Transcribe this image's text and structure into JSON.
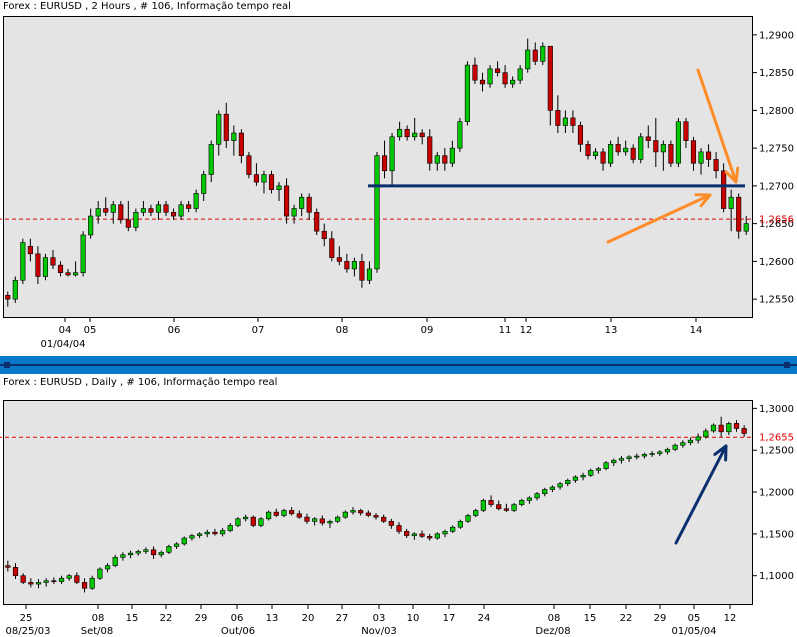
{
  "top_chart": {
    "title": "Forex : EURUSD , 2 Hours , # 106, Informação tempo real",
    "colors": {
      "up": "#00c800",
      "down": "#c80000",
      "support_line": "#0a2f6e",
      "price_line": "#e00000",
      "arrow": "#ff8c28",
      "plot_bg": "#e4e4e4"
    }
  },
  "bottom_chart": {
    "title": "Forex : EURUSD , Daily , # 106, Informação tempo real",
    "colors": {
      "up": "#00c800",
      "down": "#c80000",
      "price_line": "#e00000",
      "arrow": "#0a2f6e",
      "plot_bg": "#e4e4e4"
    }
  },
  "chart_data": [
    {
      "type": "candlestick",
      "title": "Forex : EURUSD , 2 Hours , # 106, Informação tempo real",
      "ylim": [
        1.2525,
        1.2925
      ],
      "y_ticks": [
        "1,2550",
        "1,2600",
        "1,2650",
        "1,2700",
        "1,2750",
        "1,2800",
        "1,2850",
        "1,2900"
      ],
      "x_tick_labels": [
        "04",
        "05",
        "06",
        "07",
        "08",
        "09",
        "11",
        "12",
        "13",
        "14"
      ],
      "x_sub_label": "01/04/04",
      "current_price": 1.2656,
      "current_price_label": "1,2656",
      "horizontal_lines": [
        {
          "value": 1.27,
          "color": "#0a2f6e"
        }
      ],
      "annotations": [
        "orange arrow pointing down to the support line",
        "orange arrow pointing up to the support line"
      ],
      "candles": [
        [
          1.2555,
          1.256,
          1.254,
          1.255
        ],
        [
          1.255,
          1.258,
          1.2545,
          1.2575
        ],
        [
          1.2575,
          1.263,
          1.257,
          1.2625
        ],
        [
          1.262,
          1.263,
          1.26,
          1.261
        ],
        [
          1.261,
          1.262,
          1.257,
          1.258
        ],
        [
          1.258,
          1.261,
          1.2575,
          1.2605
        ],
        [
          1.2605,
          1.2615,
          1.259,
          1.2595
        ],
        [
          1.2595,
          1.26,
          1.258,
          1.2585
        ],
        [
          1.2585,
          1.259,
          1.258,
          1.2582
        ],
        [
          1.2582,
          1.26,
          1.258,
          1.2585
        ],
        [
          1.2585,
          1.264,
          1.258,
          1.2635
        ],
        [
          1.2635,
          1.267,
          1.263,
          1.266
        ],
        [
          1.266,
          1.268,
          1.265,
          1.267
        ],
        [
          1.267,
          1.2685,
          1.266,
          1.2665
        ],
        [
          1.2665,
          1.268,
          1.265,
          1.2675
        ],
        [
          1.2675,
          1.268,
          1.265,
          1.2655
        ],
        [
          1.2655,
          1.268,
          1.264,
          1.2645
        ],
        [
          1.2645,
          1.267,
          1.264,
          1.2665
        ],
        [
          1.2665,
          1.268,
          1.266,
          1.267
        ],
        [
          1.267,
          1.2675,
          1.266,
          1.2665
        ],
        [
          1.2665,
          1.268,
          1.2655,
          1.2675
        ],
        [
          1.2675,
          1.268,
          1.266,
          1.2665
        ],
        [
          1.2665,
          1.267,
          1.2655,
          1.266
        ],
        [
          1.266,
          1.268,
          1.2655,
          1.2675
        ],
        [
          1.2675,
          1.268,
          1.2665,
          1.267
        ],
        [
          1.267,
          1.2695,
          1.2665,
          1.269
        ],
        [
          1.269,
          1.272,
          1.268,
          1.2715
        ],
        [
          1.2715,
          1.276,
          1.2705,
          1.2755
        ],
        [
          1.2755,
          1.28,
          1.274,
          1.2795
        ],
        [
          1.2795,
          1.281,
          1.275,
          1.276
        ],
        [
          1.276,
          1.278,
          1.274,
          1.277
        ],
        [
          1.277,
          1.2775,
          1.273,
          1.274
        ],
        [
          1.274,
          1.2745,
          1.271,
          1.2715
        ],
        [
          1.2715,
          1.273,
          1.27,
          1.2705
        ],
        [
          1.2705,
          1.272,
          1.269,
          1.2715
        ],
        [
          1.2715,
          1.272,
          1.269,
          1.2695
        ],
        [
          1.2695,
          1.2705,
          1.268,
          1.27
        ],
        [
          1.27,
          1.271,
          1.265,
          1.266
        ],
        [
          1.266,
          1.2675,
          1.265,
          1.267
        ],
        [
          1.267,
          1.269,
          1.266,
          1.2685
        ],
        [
          1.2685,
          1.269,
          1.2655,
          1.2665
        ],
        [
          1.2665,
          1.267,
          1.2635,
          1.264
        ],
        [
          1.264,
          1.265,
          1.262,
          1.263
        ],
        [
          1.263,
          1.264,
          1.26,
          1.2605
        ],
        [
          1.2605,
          1.262,
          1.2595,
          1.26
        ],
        [
          1.26,
          1.261,
          1.2585,
          1.259
        ],
        [
          1.259,
          1.2605,
          1.258,
          1.26
        ],
        [
          1.26,
          1.261,
          1.2565,
          1.2575
        ],
        [
          1.2575,
          1.26,
          1.257,
          1.259
        ],
        [
          1.259,
          1.2745,
          1.2585,
          1.274
        ],
        [
          1.274,
          1.276,
          1.271,
          1.272
        ],
        [
          1.272,
          1.277,
          1.27,
          1.2765
        ],
        [
          1.2765,
          1.2785,
          1.276,
          1.2775
        ],
        [
          1.2775,
          1.278,
          1.276,
          1.2765
        ],
        [
          1.2765,
          1.279,
          1.276,
          1.277
        ],
        [
          1.277,
          1.2775,
          1.2755,
          1.2765
        ],
        [
          1.2765,
          1.2775,
          1.272,
          1.273
        ],
        [
          1.273,
          1.2745,
          1.272,
          1.274
        ],
        [
          1.274,
          1.275,
          1.272,
          1.273
        ],
        [
          1.273,
          1.276,
          1.2725,
          1.275
        ],
        [
          1.275,
          1.279,
          1.2745,
          1.2785
        ],
        [
          1.2785,
          1.2865,
          1.278,
          1.286
        ],
        [
          1.286,
          1.287,
          1.2835,
          1.284
        ],
        [
          1.284,
          1.285,
          1.2825,
          1.2835
        ],
        [
          1.2835,
          1.286,
          1.283,
          1.2855
        ],
        [
          1.2855,
          1.2865,
          1.2845,
          1.285
        ],
        [
          1.285,
          1.286,
          1.283,
          1.2835
        ],
        [
          1.2835,
          1.2845,
          1.283,
          1.284
        ],
        [
          1.284,
          1.286,
          1.2835,
          1.2855
        ],
        [
          1.2855,
          1.2895,
          1.285,
          1.288
        ],
        [
          1.288,
          1.289,
          1.286,
          1.2865
        ],
        [
          1.2865,
          1.289,
          1.286,
          1.2885
        ],
        [
          1.2885,
          1.288,
          1.278,
          1.28
        ],
        [
          1.28,
          1.282,
          1.277,
          1.278
        ],
        [
          1.278,
          1.28,
          1.277,
          1.279
        ],
        [
          1.279,
          1.28,
          1.277,
          1.278
        ],
        [
          1.278,
          1.2785,
          1.2745,
          1.2755
        ],
        [
          1.2755,
          1.276,
          1.2735,
          1.274
        ],
        [
          1.274,
          1.275,
          1.2735,
          1.2745
        ],
        [
          1.2745,
          1.275,
          1.272,
          1.273
        ],
        [
          1.273,
          1.276,
          1.2725,
          1.2755
        ],
        [
          1.2755,
          1.2765,
          1.274,
          1.2745
        ],
        [
          1.2745,
          1.276,
          1.274,
          1.275
        ],
        [
          1.275,
          1.2755,
          1.273,
          1.2735
        ],
        [
          1.2735,
          1.277,
          1.273,
          1.2765
        ],
        [
          1.2765,
          1.278,
          1.275,
          1.276
        ],
        [
          1.276,
          1.279,
          1.2725,
          1.2745
        ],
        [
          1.2745,
          1.276,
          1.272,
          1.2755
        ],
        [
          1.2755,
          1.276,
          1.2725,
          1.273
        ],
        [
          1.273,
          1.279,
          1.2725,
          1.2785
        ],
        [
          1.2785,
          1.279,
          1.275,
          1.276
        ],
        [
          1.276,
          1.2765,
          1.272,
          1.273
        ],
        [
          1.273,
          1.275,
          1.2715,
          1.2745
        ],
        [
          1.2745,
          1.2755,
          1.2725,
          1.2735
        ],
        [
          1.2735,
          1.2745,
          1.271,
          1.272
        ],
        [
          1.272,
          1.273,
          1.2665,
          1.267
        ],
        [
          1.267,
          1.2695,
          1.264,
          1.2685
        ],
        [
          1.2685,
          1.269,
          1.263,
          1.264
        ],
        [
          1.264,
          1.266,
          1.2635,
          1.265
        ]
      ]
    },
    {
      "type": "candlestick",
      "title": "Forex : EURUSD , Daily , # 106, Informação tempo real",
      "ylim": [
        1.065,
        1.31
      ],
      "y_ticks": [
        "1,1000",
        "1,1500",
        "1,2000",
        "1,2500",
        "1,3000"
      ],
      "x_tick_labels": [
        "25",
        "08",
        "15",
        "22",
        "29",
        "06",
        "13",
        "20",
        "27",
        "03",
        "10",
        "17",
        "24",
        "08",
        "15",
        "22",
        "29",
        "05",
        "12"
      ],
      "x_sub_labels": [
        "08/25/03",
        "Set/08",
        "Out/06",
        "Nov/03",
        "Dez/08",
        "01/05/04"
      ],
      "current_price": 1.2655,
      "current_price_label": "1,2655",
      "annotations": [
        "dark blue arrow pointing up to the recent candles"
      ],
      "candles": [
        [
          1.112,
          1.118,
          1.105,
          1.11
        ],
        [
          1.11,
          1.115,
          1.096,
          1.1
        ],
        [
          1.1,
          1.103,
          1.09,
          1.092
        ],
        [
          1.092,
          1.097,
          1.086,
          1.09
        ],
        [
          1.09,
          1.096,
          1.085,
          1.092
        ],
        [
          1.092,
          1.097,
          1.087,
          1.094
        ],
        [
          1.094,
          1.098,
          1.09,
          1.093
        ],
        [
          1.093,
          1.1,
          1.09,
          1.097
        ],
        [
          1.097,
          1.102,
          1.094,
          1.1
        ],
        [
          1.1,
          1.104,
          1.09,
          1.092
        ],
        [
          1.092,
          1.097,
          1.08,
          1.085
        ],
        [
          1.085,
          1.1,
          1.083,
          1.097
        ],
        [
          1.097,
          1.11,
          1.095,
          1.108
        ],
        [
          1.108,
          1.115,
          1.104,
          1.112
        ],
        [
          1.112,
          1.125,
          1.11,
          1.122
        ],
        [
          1.122,
          1.128,
          1.118,
          1.125
        ],
        [
          1.125,
          1.13,
          1.121,
          1.127
        ],
        [
          1.127,
          1.131,
          1.124,
          1.129
        ],
        [
          1.129,
          1.134,
          1.126,
          1.131
        ],
        [
          1.131,
          1.135,
          1.12,
          1.125
        ],
        [
          1.125,
          1.13,
          1.122,
          1.128
        ],
        [
          1.128,
          1.137,
          1.126,
          1.135
        ],
        [
          1.135,
          1.14,
          1.132,
          1.138
        ],
        [
          1.138,
          1.147,
          1.136,
          1.145
        ],
        [
          1.145,
          1.15,
          1.142,
          1.148
        ],
        [
          1.148,
          1.152,
          1.145,
          1.15
        ],
        [
          1.15,
          1.155,
          1.146,
          1.152
        ],
        [
          1.152,
          1.156,
          1.148,
          1.15
        ],
        [
          1.15,
          1.157,
          1.147,
          1.154
        ],
        [
          1.154,
          1.163,
          1.152,
          1.16
        ],
        [
          1.16,
          1.17,
          1.158,
          1.168
        ],
        [
          1.168,
          1.173,
          1.165,
          1.17
        ],
        [
          1.17,
          1.172,
          1.158,
          1.16
        ],
        [
          1.16,
          1.17,
          1.158,
          1.168
        ],
        [
          1.168,
          1.178,
          1.166,
          1.176
        ],
        [
          1.176,
          1.18,
          1.17,
          1.172
        ],
        [
          1.172,
          1.18,
          1.17,
          1.178
        ],
        [
          1.178,
          1.182,
          1.172,
          1.174
        ],
        [
          1.174,
          1.178,
          1.168,
          1.17
        ],
        [
          1.17,
          1.174,
          1.162,
          1.165
        ],
        [
          1.165,
          1.17,
          1.16,
          1.168
        ],
        [
          1.168,
          1.172,
          1.16,
          1.163
        ],
        [
          1.163,
          1.167,
          1.157,
          1.165
        ],
        [
          1.165,
          1.172,
          1.163,
          1.17
        ],
        [
          1.17,
          1.178,
          1.168,
          1.176
        ],
        [
          1.176,
          1.182,
          1.173,
          1.178
        ],
        [
          1.178,
          1.18,
          1.172,
          1.175
        ],
        [
          1.175,
          1.178,
          1.17,
          1.172
        ],
        [
          1.172,
          1.175,
          1.167,
          1.17
        ],
        [
          1.17,
          1.173,
          1.163,
          1.165
        ],
        [
          1.165,
          1.168,
          1.156,
          1.16
        ],
        [
          1.16,
          1.164,
          1.15,
          1.153
        ],
        [
          1.153,
          1.156,
          1.145,
          1.148
        ],
        [
          1.148,
          1.152,
          1.143,
          1.15
        ],
        [
          1.15,
          1.154,
          1.145,
          1.147
        ],
        [
          1.147,
          1.15,
          1.142,
          1.145
        ],
        [
          1.145,
          1.152,
          1.143,
          1.15
        ],
        [
          1.15,
          1.155,
          1.146,
          1.153
        ],
        [
          1.153,
          1.16,
          1.151,
          1.158
        ],
        [
          1.158,
          1.167,
          1.156,
          1.165
        ],
        [
          1.165,
          1.174,
          1.163,
          1.172
        ],
        [
          1.172,
          1.18,
          1.17,
          1.178
        ],
        [
          1.178,
          1.192,
          1.176,
          1.19
        ],
        [
          1.19,
          1.196,
          1.182,
          1.185
        ],
        [
          1.185,
          1.19,
          1.178,
          1.18
        ],
        [
          1.18,
          1.186,
          1.176,
          1.178
        ],
        [
          1.178,
          1.187,
          1.176,
          1.185
        ],
        [
          1.185,
          1.192,
          1.183,
          1.19
        ],
        [
          1.19,
          1.195,
          1.186,
          1.193
        ],
        [
          1.193,
          1.2,
          1.19,
          1.198
        ],
        [
          1.198,
          1.205,
          1.195,
          1.203
        ],
        [
          1.203,
          1.208,
          1.2,
          1.206
        ],
        [
          1.206,
          1.212,
          1.203,
          1.21
        ],
        [
          1.21,
          1.216,
          1.207,
          1.214
        ],
        [
          1.214,
          1.22,
          1.211,
          1.218
        ],
        [
          1.218,
          1.223,
          1.214,
          1.22
        ],
        [
          1.22,
          1.228,
          1.218,
          1.226
        ],
        [
          1.226,
          1.23,
          1.222,
          1.228
        ],
        [
          1.228,
          1.237,
          1.226,
          1.235
        ],
        [
          1.235,
          1.24,
          1.231,
          1.238
        ],
        [
          1.238,
          1.243,
          1.234,
          1.24
        ],
        [
          1.24,
          1.244,
          1.236,
          1.242
        ],
        [
          1.242,
          1.246,
          1.239,
          1.243
        ],
        [
          1.243,
          1.247,
          1.24,
          1.245
        ],
        [
          1.245,
          1.249,
          1.242,
          1.246
        ],
        [
          1.246,
          1.25,
          1.243,
          1.248
        ],
        [
          1.248,
          1.253,
          1.245,
          1.251
        ],
        [
          1.251,
          1.258,
          1.249,
          1.256
        ],
        [
          1.256,
          1.262,
          1.253,
          1.259
        ],
        [
          1.259,
          1.265,
          1.256,
          1.262
        ],
        [
          1.262,
          1.27,
          1.258,
          1.266
        ],
        [
          1.266,
          1.276,
          1.264,
          1.273
        ],
        [
          1.273,
          1.282,
          1.271,
          1.28
        ],
        [
          1.28,
          1.29,
          1.266,
          1.272
        ],
        [
          1.272,
          1.284,
          1.268,
          1.282
        ],
        [
          1.282,
          1.286,
          1.272,
          1.276
        ],
        [
          1.276,
          1.28,
          1.266,
          1.27
        ]
      ]
    }
  ]
}
